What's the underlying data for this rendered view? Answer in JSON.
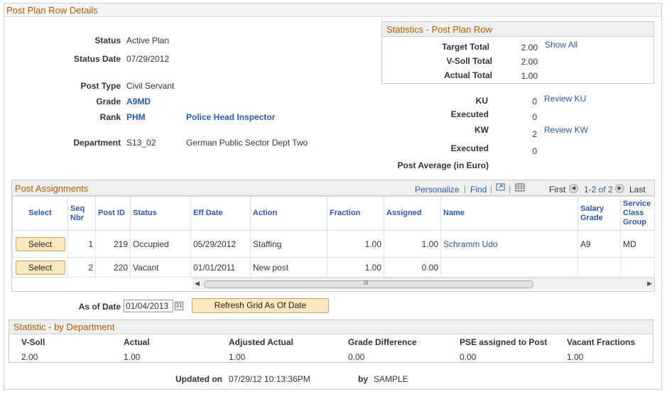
{
  "page": {
    "title": "Post Plan Row Details"
  },
  "details": {
    "status_label": "Status",
    "status_value": "Active Plan",
    "status_date_label": "Status Date",
    "status_date_value": "07/29/2012",
    "post_type_label": "Post Type",
    "post_type_value": "Civil Servant",
    "grade_label": "Grade",
    "grade_value": "A9MD",
    "rank_label": "Rank",
    "rank_code": "PHM",
    "rank_desc": "Police Head Inspector",
    "department_label": "Department",
    "department_code": "S13_02",
    "department_desc": "German Public Sector Dept Two"
  },
  "stats": {
    "title": "Statistics - Post Plan Row",
    "target_total_label": "Target Total",
    "target_total_value": "2.00",
    "show_all_link": "Show All",
    "vsoll_total_label": "V-Soll Total",
    "vsoll_total_value": "2.00",
    "actual_total_label": "Actual Total",
    "actual_total_value": "1.00",
    "ku_label": "KU",
    "ku_value": "0",
    "review_ku_link": "Review KU",
    "ku_executed_label": "Executed",
    "ku_executed_value": "0",
    "kw_label": "KW",
    "kw_value": "2",
    "review_kw_link": "Review KW",
    "kw_executed_label": "Executed",
    "kw_executed_value": "0",
    "post_average_label": "Post Average (in Euro)"
  },
  "grid": {
    "title": "Post Assignments",
    "personalize": "Personalize",
    "find": "Find",
    "first": "First",
    "range": "1-2 of 2",
    "last": "Last",
    "headers": {
      "select": "Select",
      "seq": "Seq Nbr",
      "post_id": "Post ID",
      "status": "Status",
      "eff_date": "Eff Date",
      "action": "Action",
      "fraction": "Fraction",
      "assigned": "Assigned",
      "name": "Name",
      "salary_grade": "Salary Grade",
      "service_class": "Service Class Group"
    },
    "rows": [
      {
        "select": "Select",
        "seq": "1",
        "post_id": "219",
        "status": "Occupied",
        "eff_date": "05/29/2012",
        "action": "Staffing",
        "fraction": "1.00",
        "assigned": "1.00",
        "name": "Schramm Udo",
        "salary_grade": "A9",
        "service_class": "MD"
      },
      {
        "select": "Select",
        "seq": "2",
        "post_id": "220",
        "status": "Vacant",
        "eff_date": "01/01/2011",
        "action": "New post",
        "fraction": "1.00",
        "assigned": "0.00",
        "name": "",
        "salary_grade": "",
        "service_class": ""
      }
    ],
    "scroll_grip": "III"
  },
  "as_of": {
    "label": "As of Date",
    "value": "01/04/2013",
    "calendar_glyph": "31",
    "refresh_button": "Refresh Grid As Of Date"
  },
  "dept_stats": {
    "title": "Statistic - by Department",
    "headers": [
      "V-Soll",
      "Actual",
      "Adjusted Actual",
      "Grade Difference",
      "PSE assigned to Post",
      "Vacant Fractions"
    ],
    "values": [
      "2.00",
      "1.00",
      "1.00",
      "0.00",
      "0.00",
      "1.00"
    ]
  },
  "footer": {
    "updated_label": "Updated on",
    "updated_value": "07/29/12 10:13:36PM",
    "by_label": "by",
    "by_value": "SAMPLE"
  },
  "colors": {
    "section_title": "#b05a00",
    "link": "#2c5aa6",
    "button_bg": "#fce6bd"
  }
}
